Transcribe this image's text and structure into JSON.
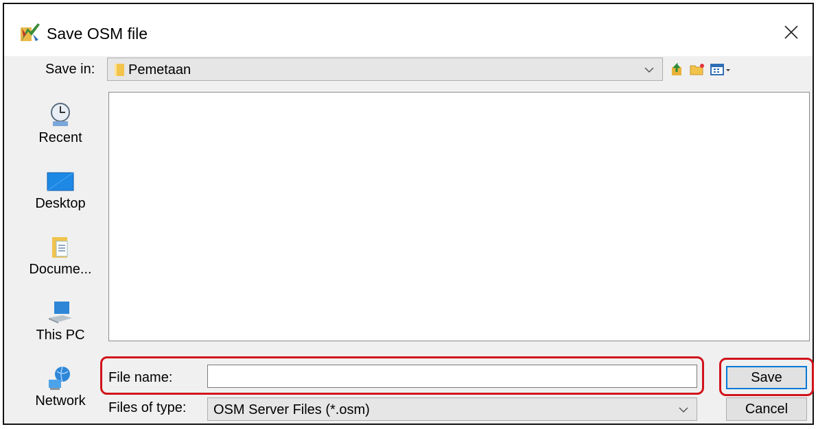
{
  "window": {
    "title": "Save OSM file",
    "app_icon": "josm-app-icon",
    "close_icon": "close-icon"
  },
  "toolbar": {
    "save_in_label": "Save in:",
    "location": "Pemetaan",
    "icons": [
      "up-one-level-icon",
      "new-folder-icon",
      "view-menu-icon"
    ]
  },
  "places": [
    {
      "label": "Recent",
      "icon": "recent-clock-icon"
    },
    {
      "label": "Desktop",
      "icon": "desktop-icon"
    },
    {
      "label": "Docume...",
      "icon": "documents-icon"
    },
    {
      "label": "This PC",
      "icon": "computer-icon"
    },
    {
      "label": "Network",
      "icon": "network-globe-icon"
    }
  ],
  "form": {
    "file_name_label": "File name:",
    "file_name_value": "",
    "file_type_label": "Files of type:",
    "file_type_value": "OSM Server Files (*.osm)",
    "save_label": "Save",
    "cancel_label": "Cancel"
  },
  "colors": {
    "highlight": "#d1121a",
    "accent": "#0078d7"
  }
}
